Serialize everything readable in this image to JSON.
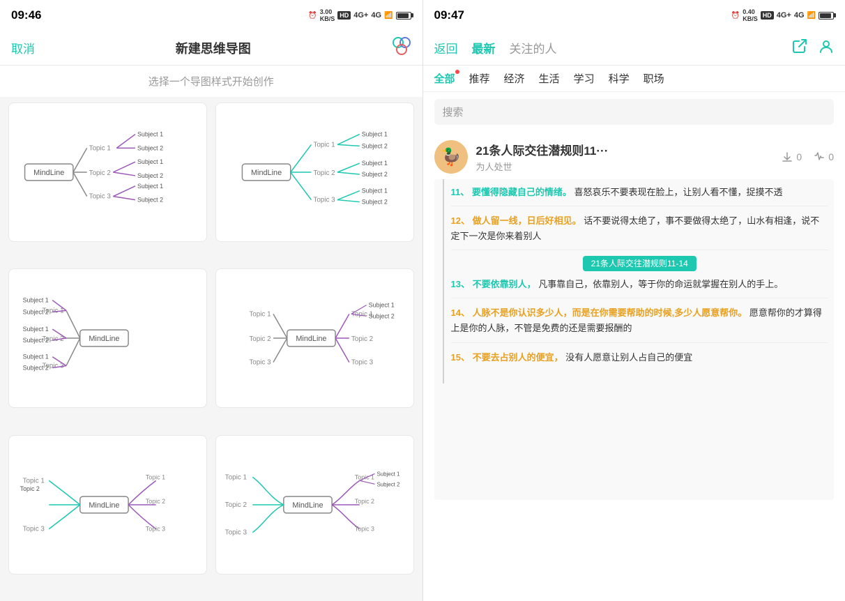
{
  "left": {
    "status": {
      "time": "09:46",
      "icons": "3.00 KB/S HD 4G+ 4G"
    },
    "header": {
      "cancel": "取消",
      "title": "新建思维导图",
      "icon": "⊕"
    },
    "subtitle": "选择一个导图样式开始创作",
    "cards": [
      {
        "id": "card1",
        "type": "right-branch"
      },
      {
        "id": "card2",
        "type": "right-branch-simple"
      },
      {
        "id": "card3",
        "type": "left-branch"
      },
      {
        "id": "card4",
        "type": "center-branch"
      },
      {
        "id": "card5",
        "type": "curved-left"
      },
      {
        "id": "card6",
        "type": "curved-center"
      }
    ]
  },
  "right": {
    "status": {
      "time": "09:47"
    },
    "header": {
      "back": "返回",
      "latest": "最新",
      "following": "关注的人"
    },
    "categories": [
      "全部",
      "推荐",
      "经济",
      "生活",
      "学习",
      "科学",
      "职场"
    ],
    "search_placeholder": "搜索",
    "article": {
      "title": "21条人际交往潜规则11···",
      "subtitle": "为人处世",
      "download_count": "0",
      "like_count": "0",
      "label": "21条人际交往潜规则11-14",
      "sections": [
        {
          "num": "11",
          "title": "要懂得隐藏自己的情绪。",
          "body": "喜怒哀乐不要表现在脸上，让别人看不懂，捉摸不透"
        },
        {
          "num": "12",
          "title": "做人留一线，日后好相见。",
          "body": "话不要说得太绝了，事不要做得太绝了，山水有相逢，说不定下一次是你来着别人"
        },
        {
          "num": "13",
          "title": "不要依靠别人，",
          "body": "凡事靠自己，依靠别人，等于你的命运就掌握在别人的手上。"
        },
        {
          "num": "14",
          "title": "人脉不是你认识多少人，而是在你需要帮助的时候,多少人愿意帮你。",
          "body": "愿意帮你的才算得上是你的人脉，不管是免费的还是需要报酬的"
        },
        {
          "num": "15",
          "title": "不要去占别人的便宜，",
          "body": "没有人愿意让别人占自己的便宜"
        }
      ]
    }
  }
}
